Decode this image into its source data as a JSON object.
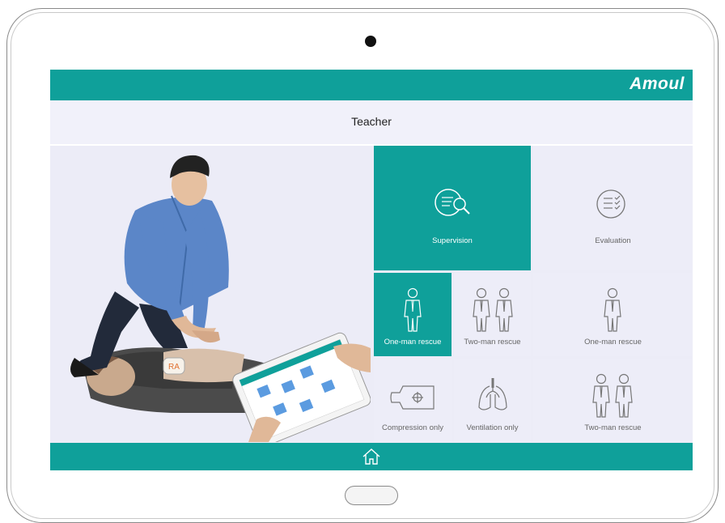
{
  "header": {
    "logo": "Amoul",
    "title": "Teacher"
  },
  "tiles": {
    "supervision": {
      "label": "Supervision",
      "icon": "search-list-icon",
      "active": true
    },
    "evaluation": {
      "label": "Evaluation",
      "icon": "checklist-icon"
    },
    "one_man_a": {
      "label": "One-man rescue",
      "icon": "person-icon",
      "active": true
    },
    "two_man_a": {
      "label": "Two-man rescue",
      "icon": "two-person-icon"
    },
    "one_man_b": {
      "label": "One-man rescue",
      "icon": "person-icon"
    },
    "compression": {
      "label": "Compression only",
      "icon": "manikin-torso-icon"
    },
    "ventilation": {
      "label": "Ventilation only",
      "icon": "lungs-icon"
    },
    "two_man_b": {
      "label": "Two-man rescue",
      "icon": "two-person-icon"
    }
  },
  "footer": {
    "home_icon": "home-icon"
  },
  "colors": {
    "accent": "#0fa09a",
    "tile_bg": "#ededf8",
    "label": "#666666"
  }
}
